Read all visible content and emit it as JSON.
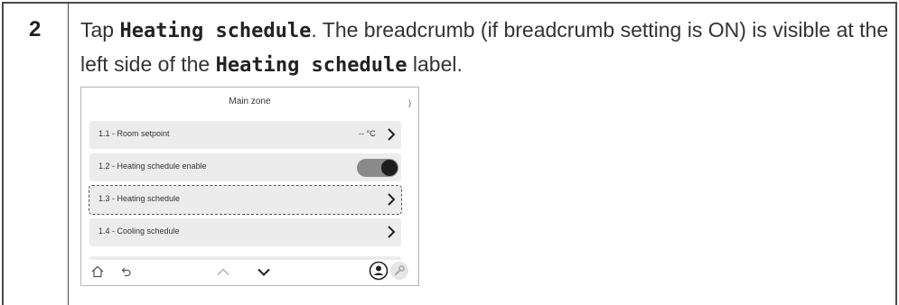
{
  "step": {
    "number": "2",
    "text": {
      "part1": "Tap ",
      "term1": "Heating schedule",
      "part2": ". The breadcrumb (if breadcrumb setting is ON) is visible at the left side of the ",
      "term2": "Heating schedule",
      "part3": " label."
    }
  },
  "screen": {
    "title": "Main zone",
    "corner_mark": ")",
    "rows": [
      {
        "label": "1.1 - Room setpoint",
        "value": "-- °C",
        "control": "chevron"
      },
      {
        "label": "1.2 - Heating schedule enable",
        "value": "",
        "control": "toggle",
        "toggle_on": true
      },
      {
        "label": "1.3 - Heating schedule",
        "value": "",
        "control": "chevron",
        "highlighted": true
      },
      {
        "label": "1.4 - Cooling schedule",
        "value": "",
        "control": "chevron"
      }
    ],
    "bottom_bar": {
      "icons": [
        "home-icon",
        "back-icon",
        "chevron-up-icon",
        "chevron-down-icon",
        "user-icon",
        "wrench-icon"
      ]
    }
  }
}
